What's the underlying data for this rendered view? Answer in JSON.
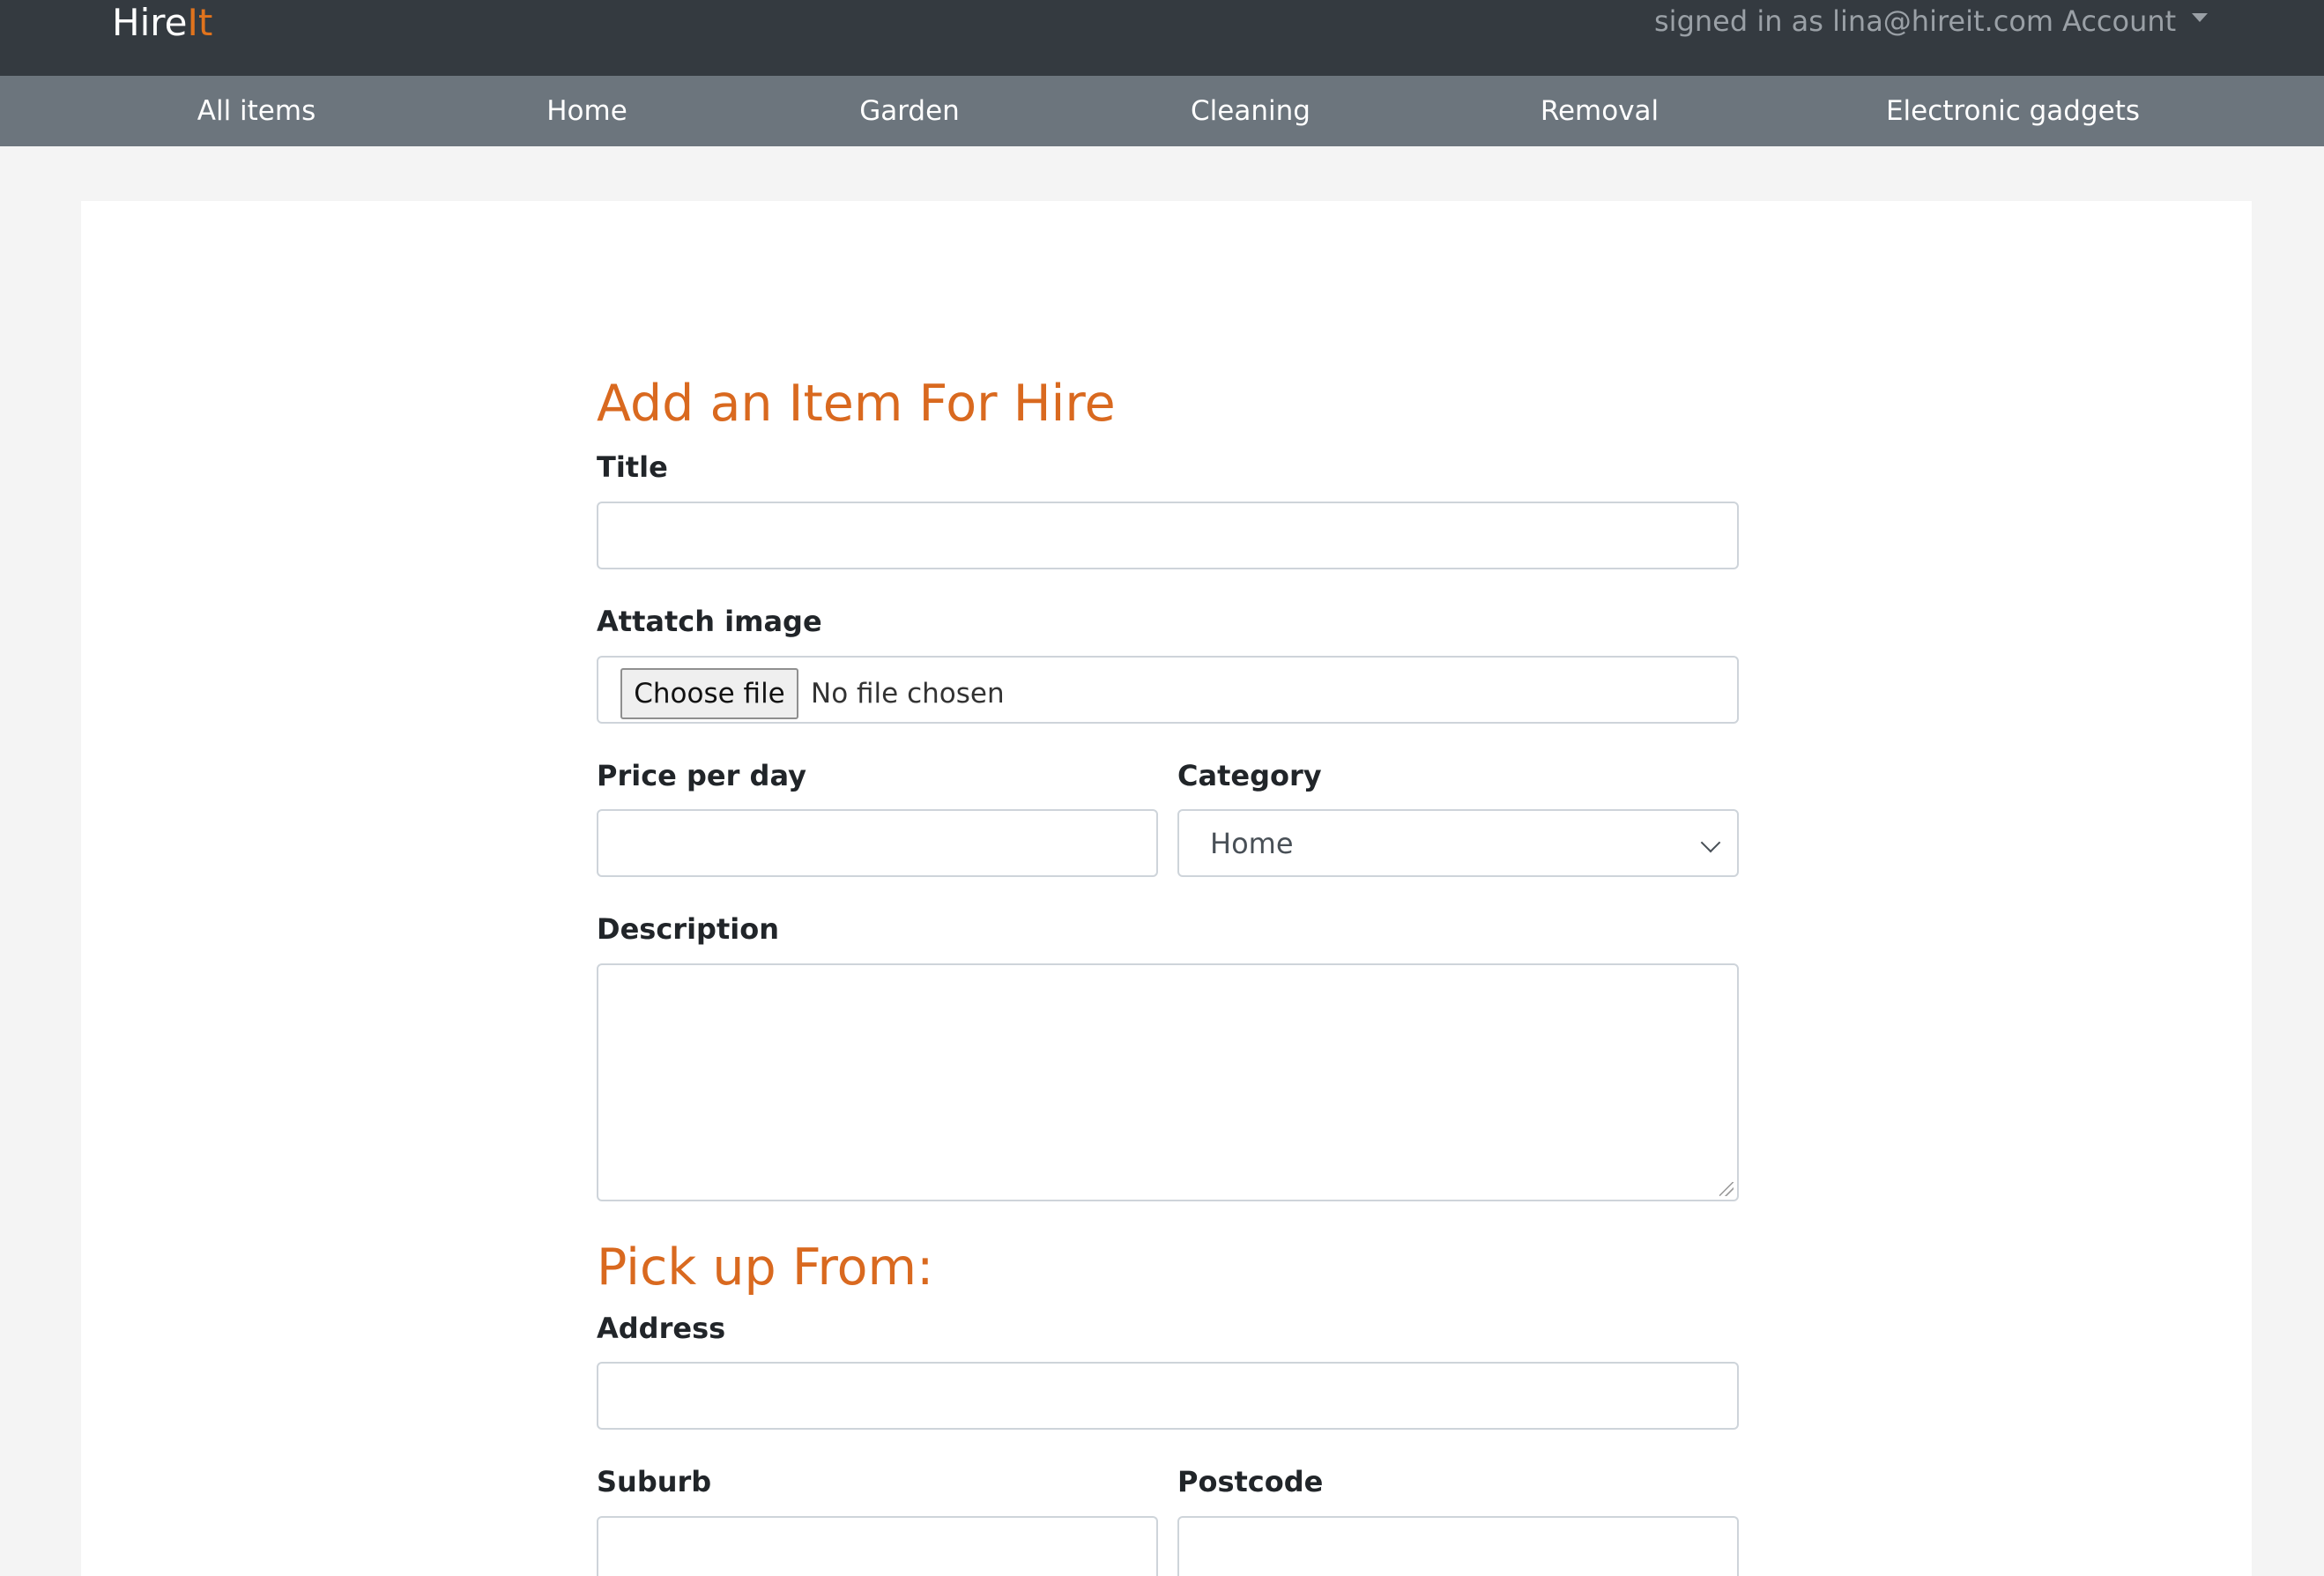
{
  "header": {
    "brand_main": "Hire",
    "brand_accent": "It",
    "signed_in_text": "signed in as lina@hireit.com",
    "account_label": "Account"
  },
  "categories": [
    "All items",
    "Home",
    "Garden",
    "Cleaning",
    "Removal",
    "Electronic gadgets"
  ],
  "form": {
    "heading": "Add an Item For Hire",
    "title_label": "Title",
    "title_value": "",
    "image_label": "Attatch image",
    "choose_file_label": "Choose file",
    "file_status": "No file chosen",
    "price_label": "Price per day",
    "price_value": "",
    "category_label": "Category",
    "category_selected": "Home",
    "description_label": "Description",
    "description_value": "",
    "pickup_heading": "Pick up From:",
    "address_label": "Address",
    "address_value": "",
    "suburb_label": "Suburb",
    "suburb_value": "",
    "postcode_label": "Postcode",
    "postcode_value": ""
  },
  "colors": {
    "navbar": "#343a40",
    "category_bar": "#6c757d",
    "accent": "#d9691f",
    "page_background": "#f4f4f4"
  },
  "icons": {
    "account_dropdown": "caret-down-icon",
    "category_dropdown": "chevron-down-icon"
  }
}
